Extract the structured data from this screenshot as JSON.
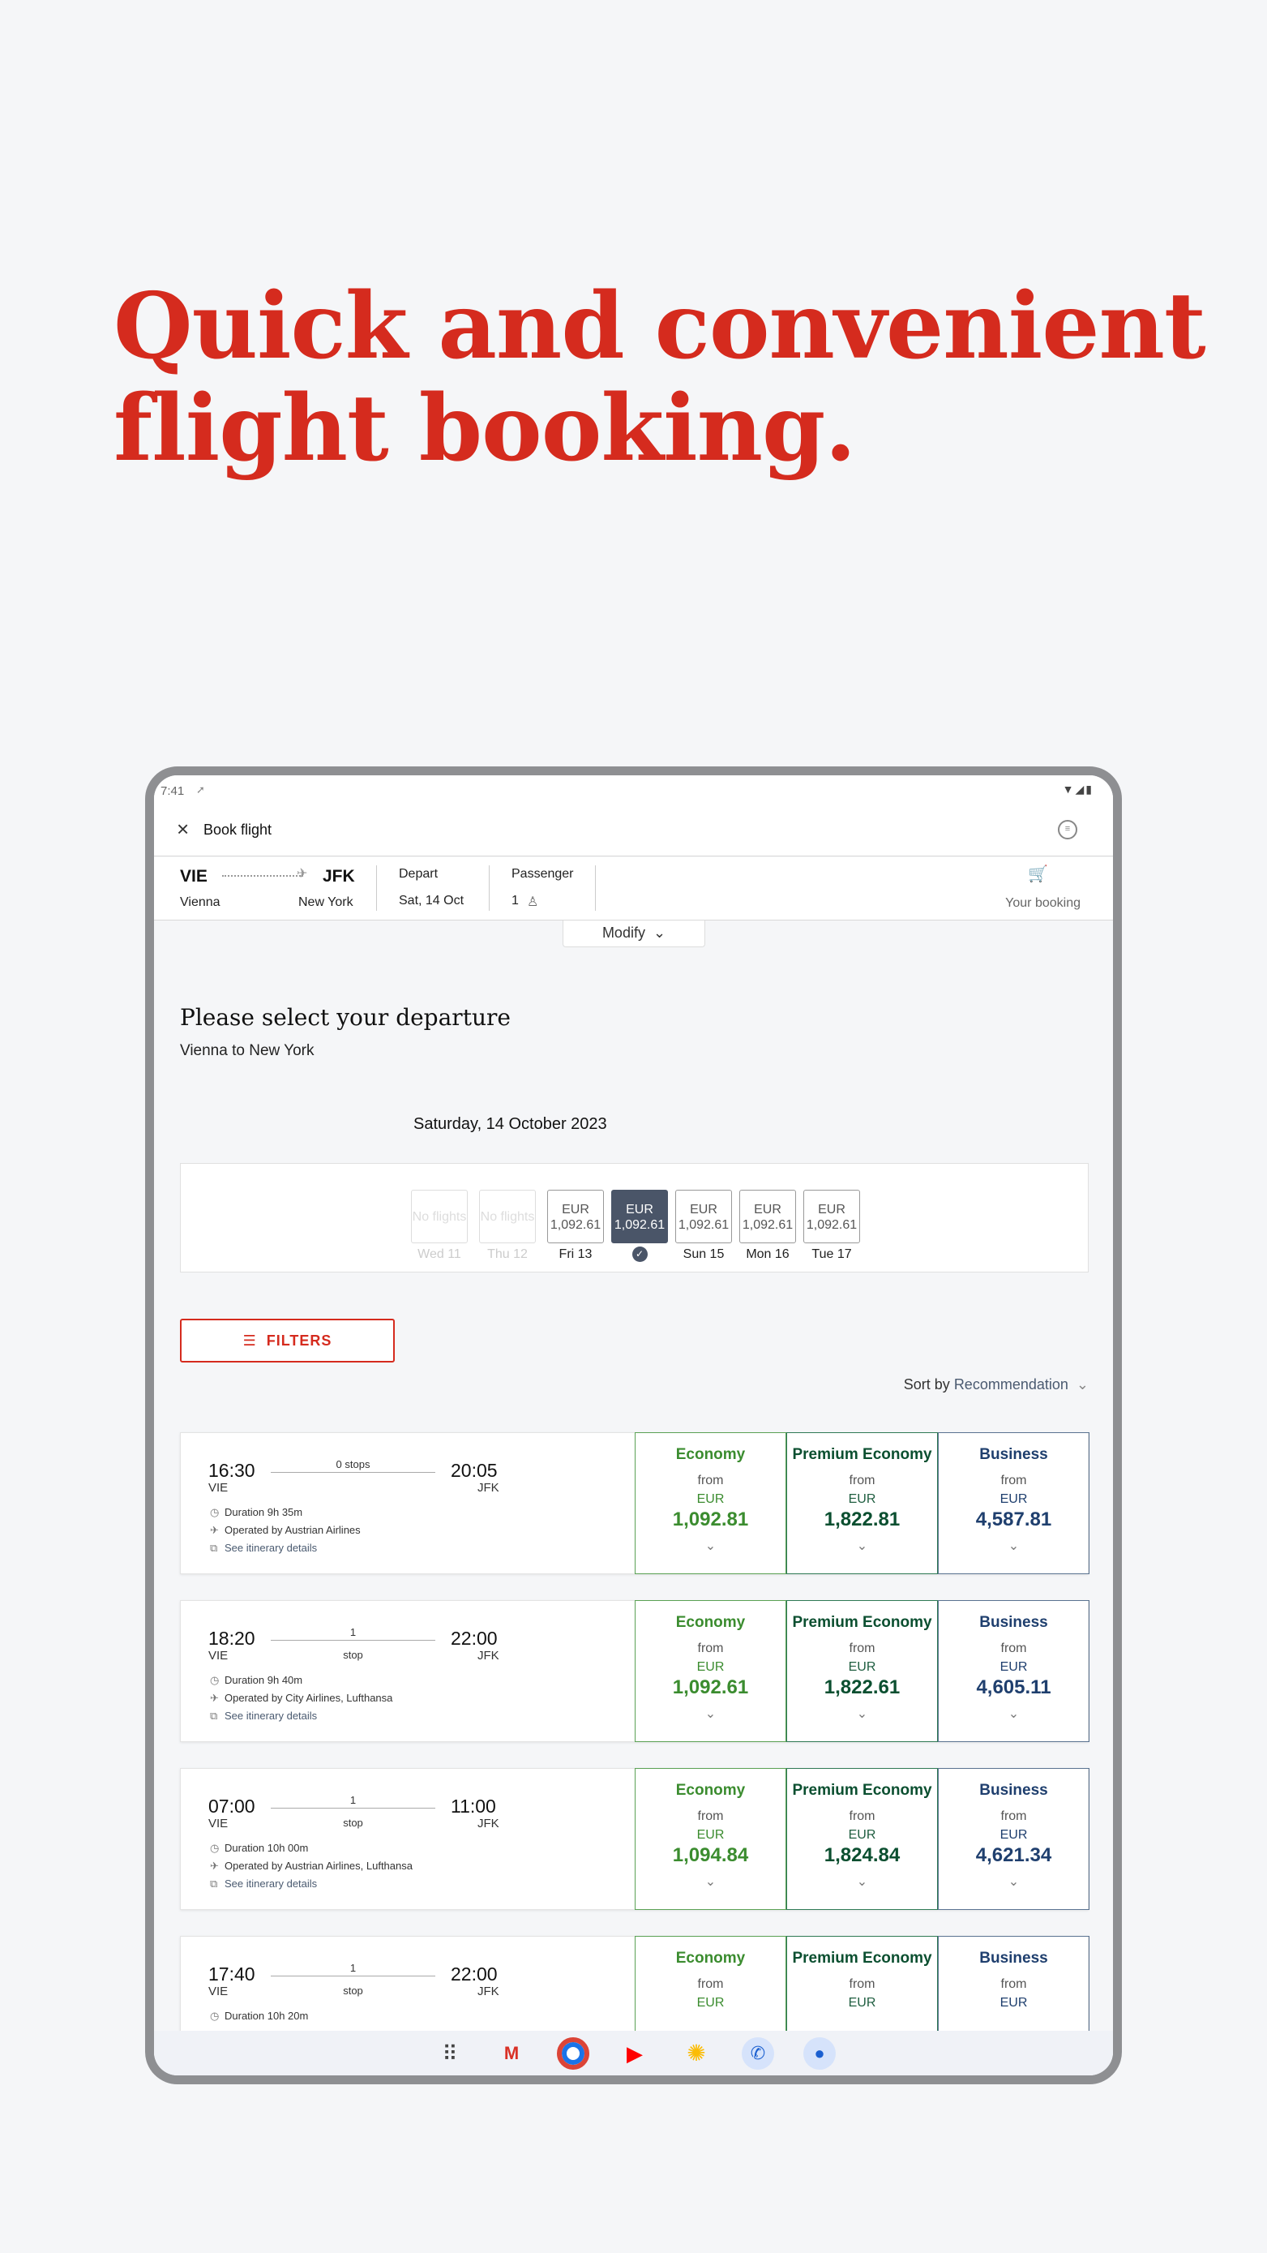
{
  "headline": {
    "line1": "Quick and convenient",
    "line2": "flight booking."
  },
  "statusbar": {
    "time": "7:41",
    "icons": [
      "wifi-icon",
      "signal-icon",
      "battery-icon"
    ]
  },
  "appbar": {
    "title": "Book flight"
  },
  "summary": {
    "origin_code": "VIE",
    "origin_city": "Vienna",
    "dest_code": "JFK",
    "dest_city": "New York",
    "depart_label": "Depart",
    "depart_value": "Sat, 14 Oct",
    "passenger_label": "Passenger",
    "passenger_value": "1",
    "booking_label": "Your booking"
  },
  "modify_label": "Modify",
  "section": {
    "title": "Please select your departure",
    "subtitle": "Vienna to New York"
  },
  "date_label": "Saturday, 14 October 2023",
  "days": [
    {
      "label": "Wed 11",
      "price_line1": "No flights",
      "price_line2": "",
      "state": "disabled"
    },
    {
      "label": "Thu 12",
      "price_line1": "No flights",
      "price_line2": "",
      "state": "disabled"
    },
    {
      "label": "Fri 13",
      "price_line1": "EUR",
      "price_line2": "1,092.61",
      "state": "normal"
    },
    {
      "label": "",
      "price_line1": "EUR",
      "price_line2": "1,092.61",
      "state": "selected"
    },
    {
      "label": "Sun 15",
      "price_line1": "EUR",
      "price_line2": "1,092.61",
      "state": "normal"
    },
    {
      "label": "Mon 16",
      "price_line1": "EUR",
      "price_line2": "1,092.61",
      "state": "normal"
    },
    {
      "label": "Tue 17",
      "price_line1": "EUR",
      "price_line2": "1,092.61",
      "state": "normal"
    }
  ],
  "filters_label": "FILTERS",
  "sort": {
    "label": "Sort by",
    "value": "Recommendation"
  },
  "fare_labels": {
    "economy": "Economy",
    "premium": "Premium Economy",
    "business": "Business",
    "from": "from",
    "currency": "EUR"
  },
  "flights": [
    {
      "dep_time": "16:30",
      "dep_code": "VIE",
      "arr_time": "20:05",
      "arr_code": "JFK",
      "stops": "0 stops",
      "stops_sub": "",
      "duration": "Duration 9h 35m",
      "operated": "Operated by Austrian Airlines",
      "details": "See itinerary details",
      "economy": "1,092.81",
      "premium": "1,822.81",
      "business": "4,587.81"
    },
    {
      "dep_time": "18:20",
      "dep_code": "VIE",
      "arr_time": "22:00",
      "arr_code": "JFK",
      "stops": "1",
      "stops_sub": "stop",
      "duration": "Duration 9h 40m",
      "operated": "Operated by City Airlines, Lufthansa",
      "details": "See itinerary details",
      "economy": "1,092.61",
      "premium": "1,822.61",
      "business": "4,605.11"
    },
    {
      "dep_time": "07:00",
      "dep_code": "VIE",
      "arr_time": "11:00",
      "arr_code": "JFK",
      "stops": "1",
      "stops_sub": "stop",
      "duration": "Duration 10h 00m",
      "operated": "Operated by Austrian Airlines, Lufthansa",
      "details": "See itinerary details",
      "economy": "1,094.84",
      "premium": "1,824.84",
      "business": "4,621.34"
    },
    {
      "dep_time": "17:40",
      "dep_code": "VIE",
      "arr_time": "22:00",
      "arr_code": "JFK",
      "stops": "1",
      "stops_sub": "stop",
      "duration": "Duration 10h 20m",
      "operated": "",
      "details": "",
      "economy": "",
      "premium": "",
      "business": ""
    }
  ],
  "dock_apps": [
    "apps-grid-icon",
    "gmail-icon",
    "chrome-icon",
    "youtube-icon",
    "photos-icon",
    "phone-icon",
    "messages-icon"
  ],
  "colors": {
    "brand_red": "#d52b1e",
    "economy_green": "#3b8c2f",
    "premium_green": "#0b4f30",
    "business_blue": "#1f3f6e",
    "selected_day": "#4a5568"
  }
}
